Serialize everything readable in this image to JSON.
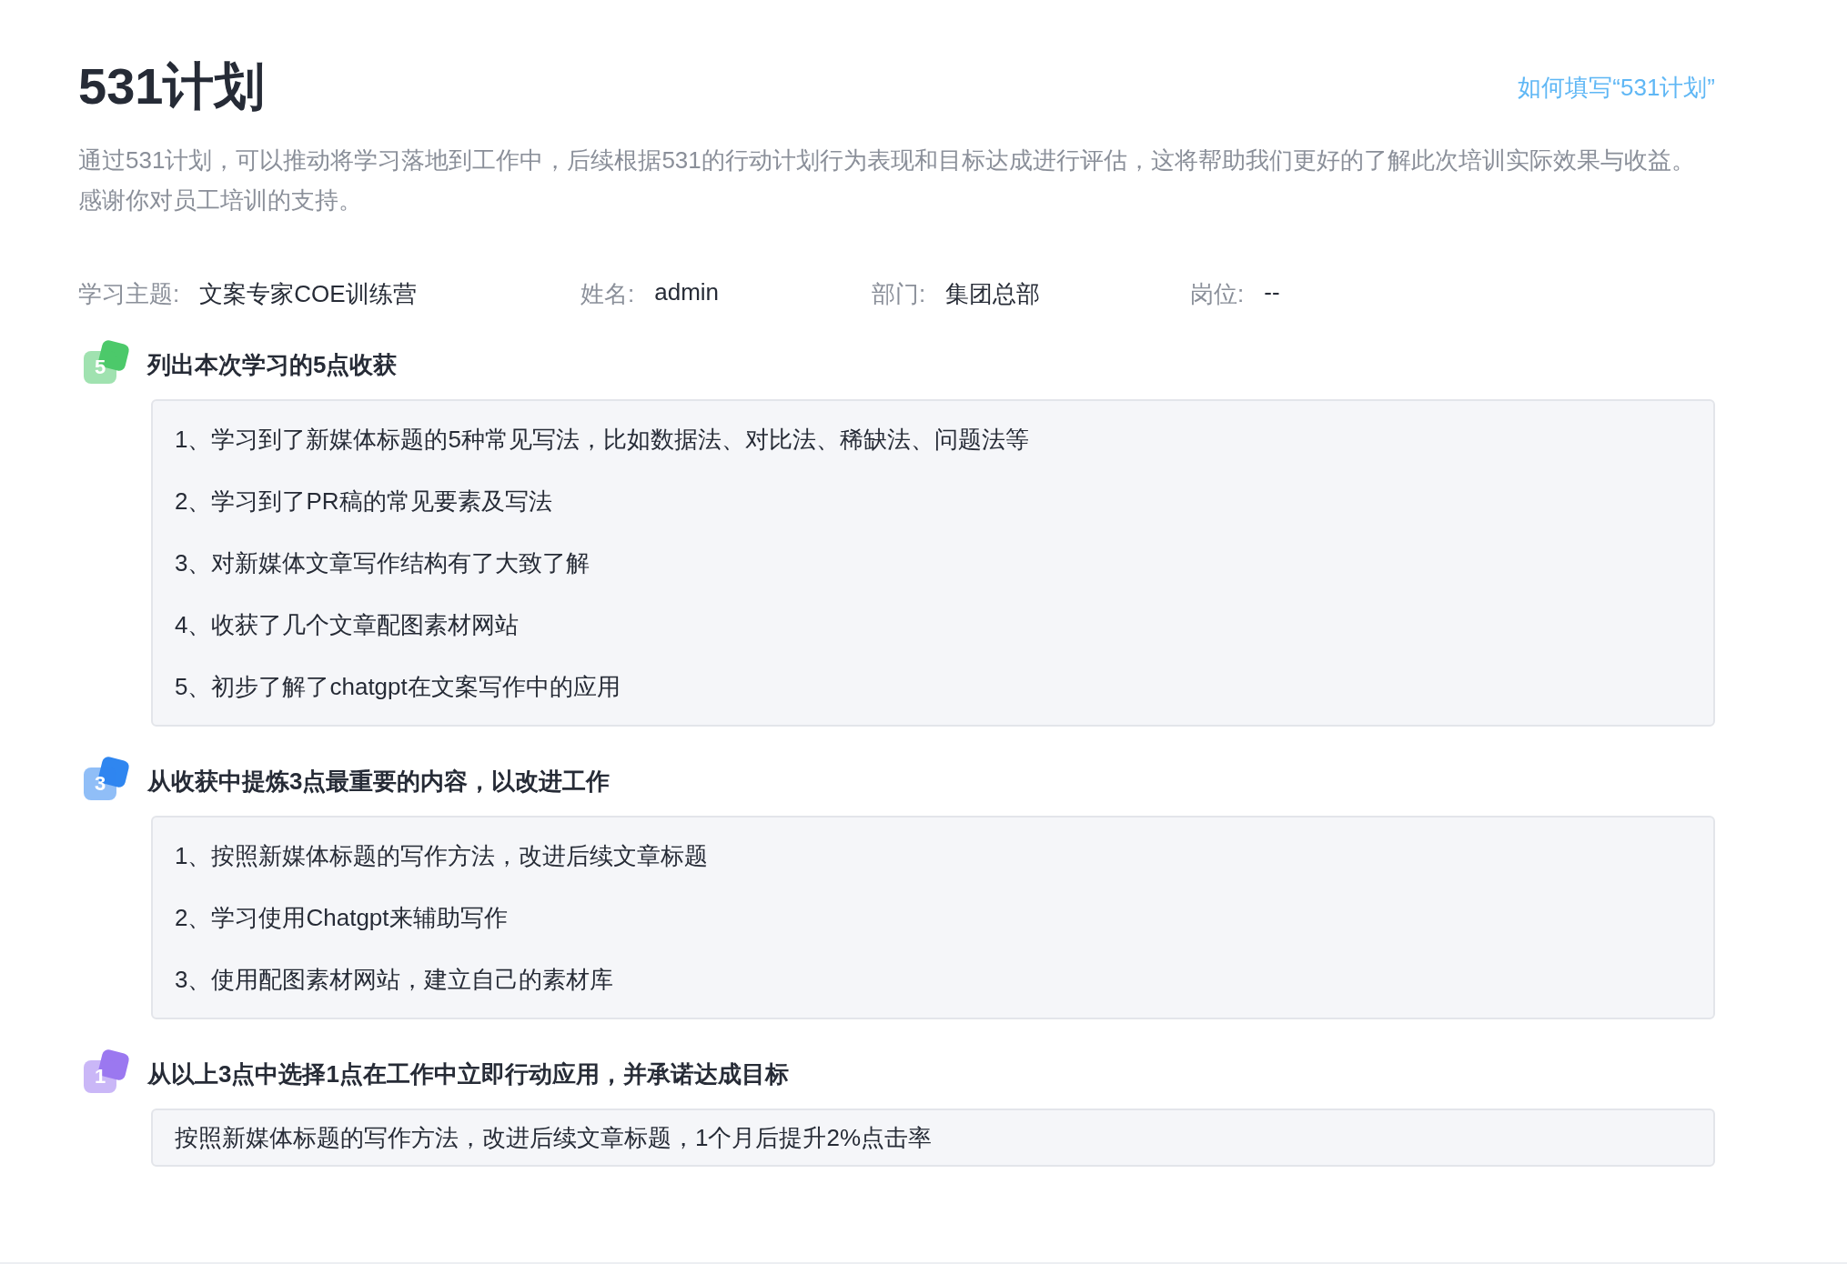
{
  "title": "531计划",
  "help_link": "如何填写“531计划”",
  "description": "通过531计划，可以推动将学习落地到工作中，后续根据531的行动计划行为表现和目标达成进行评估，这将帮助我们更好的了解此次培训实际效果与收益。感谢你对员工培训的支持。",
  "info": [
    {
      "label": "学习主题:",
      "value": "文案专家COE训练营"
    },
    {
      "label": "姓名:",
      "value": "admin"
    },
    {
      "label": "部门:",
      "value": "集团总部"
    },
    {
      "label": "岗位:",
      "value": "--"
    }
  ],
  "sections": [
    {
      "badge": "5",
      "color": "#4cc96a",
      "heading": "列出本次学习的5点收获",
      "items": [
        "1、学习到了新媒体标题的5种常见写法，比如数据法、对比法、稀缺法、问题法等",
        "2、学习到了PR稿的常见要素及写法",
        "3、对新媒体文章写作结构有了大致了解",
        "4、收获了几个文章配图素材网站",
        "5、初步了解了chatgpt在文案写作中的应用"
      ]
    },
    {
      "badge": "3",
      "color": "#2f86f0",
      "heading": "从收获中提炼3点最重要的内容，以改进工作",
      "items": [
        "1、按照新媒体标题的写作方法，改进后续文章标题",
        "2、学习使用Chatgpt来辅助写作",
        "3、使用配图素材网站，建立自己的素材库"
      ]
    },
    {
      "badge": "1",
      "color": "#9b78f0",
      "heading": "从以上3点中选择1点在工作中立即行动应用，并承诺达成目标",
      "items": [
        "按照新媒体标题的写作方法，改进后续文章标题，1个月后提升2%点击率"
      ]
    }
  ]
}
